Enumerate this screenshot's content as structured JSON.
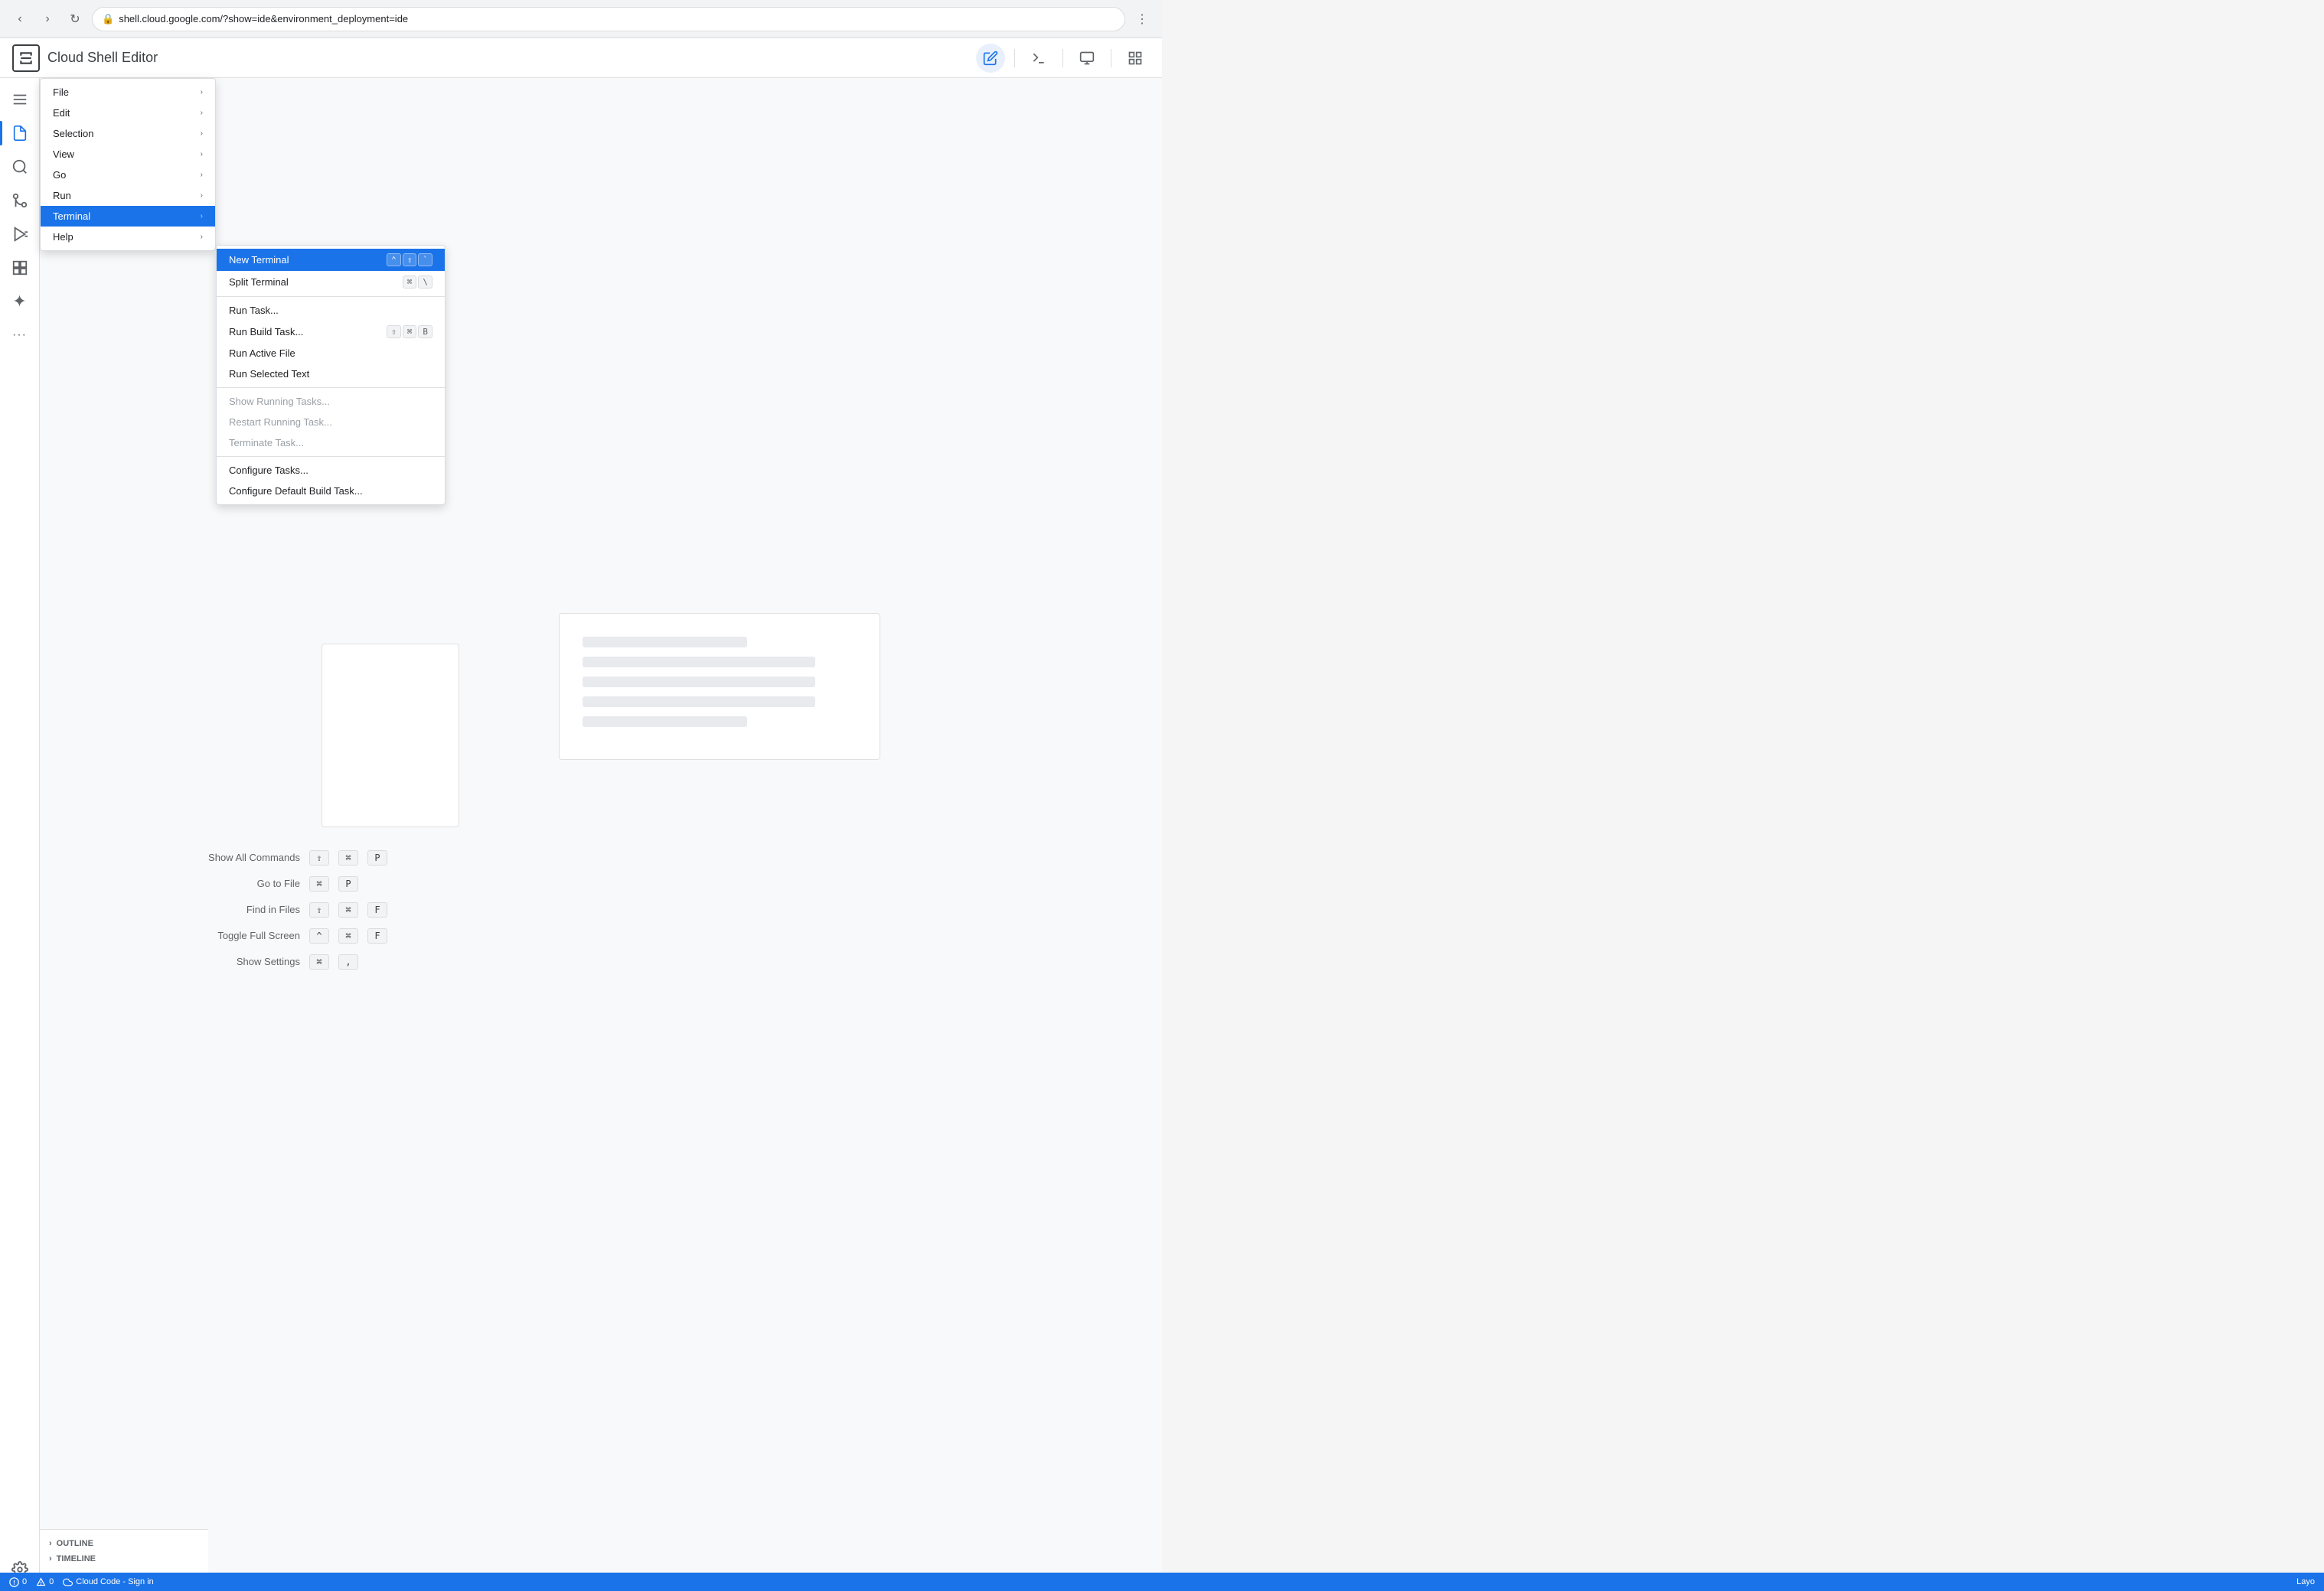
{
  "browser": {
    "url": "shell.cloud.google.com/?show=ide&environment_deployment=ide",
    "back_title": "Back",
    "forward_title": "Forward",
    "refresh_title": "Refresh"
  },
  "header": {
    "title": "Cloud Shell Editor",
    "logo_symbol": "▶",
    "edit_icon": "✏",
    "terminal_icon": "⬛",
    "screen_icon": "🖥"
  },
  "activity_bar": {
    "items": [
      {
        "name": "menu",
        "icon": "☰"
      },
      {
        "name": "explorer",
        "icon": "⬜"
      },
      {
        "name": "search",
        "icon": "🔍"
      },
      {
        "name": "source-control",
        "icon": "⑂"
      },
      {
        "name": "run",
        "icon": "▶"
      },
      {
        "name": "extensions",
        "icon": "⬡"
      },
      {
        "name": "gemini",
        "icon": "✦"
      },
      {
        "name": "more",
        "icon": "···"
      }
    ],
    "bottom": [
      {
        "name": "settings",
        "icon": "⚙"
      }
    ]
  },
  "menu": {
    "items": [
      {
        "label": "File",
        "has_submenu": true
      },
      {
        "label": "Edit",
        "has_submenu": true
      },
      {
        "label": "Selection",
        "has_submenu": true
      },
      {
        "label": "View",
        "has_submenu": true
      },
      {
        "label": "Go",
        "has_submenu": true
      },
      {
        "label": "Run",
        "has_submenu": true
      },
      {
        "label": "Terminal",
        "has_submenu": true,
        "active": true
      },
      {
        "label": "Help",
        "has_submenu": true
      }
    ]
  },
  "submenu": {
    "items": [
      {
        "label": "New Terminal",
        "shortcut": "⌃⇧`",
        "highlighted": true,
        "disabled": false,
        "separator_after": false
      },
      {
        "label": "Split Terminal",
        "shortcut": "⌘\\",
        "highlighted": false,
        "disabled": false,
        "separator_after": true
      },
      {
        "label": "Run Task...",
        "shortcut": "",
        "highlighted": false,
        "disabled": false,
        "separator_after": false
      },
      {
        "label": "Run Build Task...",
        "shortcut": "⇧⌘B",
        "highlighted": false,
        "disabled": false,
        "separator_after": false
      },
      {
        "label": "Run Active File",
        "shortcut": "",
        "highlighted": false,
        "disabled": false,
        "separator_after": false
      },
      {
        "label": "Run Selected Text",
        "shortcut": "",
        "highlighted": false,
        "disabled": false,
        "separator_after": true
      },
      {
        "label": "Show Running Tasks...",
        "shortcut": "",
        "highlighted": false,
        "disabled": true,
        "separator_after": false
      },
      {
        "label": "Restart Running Task...",
        "shortcut": "",
        "highlighted": false,
        "disabled": true,
        "separator_after": false
      },
      {
        "label": "Terminate Task...",
        "shortcut": "",
        "highlighted": false,
        "disabled": true,
        "separator_after": true
      },
      {
        "label": "Configure Tasks...",
        "shortcut": "",
        "highlighted": false,
        "disabled": false,
        "separator_after": false
      },
      {
        "label": "Configure Default Build Task...",
        "shortcut": "",
        "highlighted": false,
        "disabled": false,
        "separator_after": false
      }
    ]
  },
  "shortcuts": [
    {
      "label": "Show All Commands",
      "keys": [
        "⇧",
        "⌘",
        "P"
      ]
    },
    {
      "label": "Go to File",
      "keys": [
        "⌘",
        "P"
      ]
    },
    {
      "label": "Find in Files",
      "keys": [
        "⇧",
        "⌘",
        "F"
      ]
    },
    {
      "label": "Toggle Full Screen",
      "keys": [
        "^",
        "⌘",
        "F"
      ]
    },
    {
      "label": "Show Settings",
      "keys": [
        "⌘",
        ","
      ]
    }
  ],
  "bottom_bar": {
    "errors": "0",
    "warnings": "0",
    "cloud_code": "Cloud Code - Sign in",
    "layout": "Layo"
  },
  "sidebar": {
    "outline_label": "OUTLINE",
    "timeline_label": "TIMELINE"
  }
}
